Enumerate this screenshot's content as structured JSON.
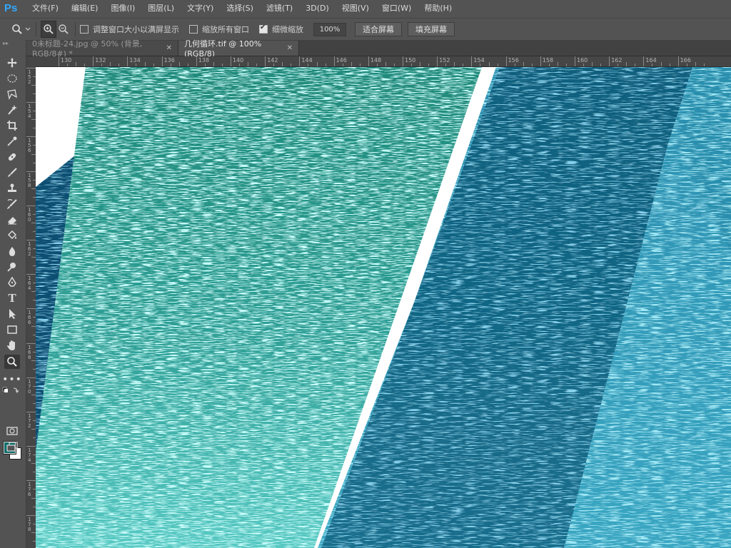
{
  "app": {
    "logo": "Ps"
  },
  "menu": [
    "文件(F)",
    "编辑(E)",
    "图像(I)",
    "图层(L)",
    "文字(Y)",
    "选择(S)",
    "滤镜(T)",
    "3D(D)",
    "视图(V)",
    "窗口(W)",
    "帮助(H)"
  ],
  "options": {
    "resize_windows": "调整窗口大小以满屏显示",
    "resize_windows_checked": false,
    "zoom_all": "缩放所有窗口",
    "zoom_all_checked": false,
    "scrubby_zoom": "细微缩放",
    "scrubby_zoom_checked": true,
    "zoom_value": "100%",
    "fit_screen": "适合屏幕",
    "fill_screen": "填充屏幕"
  },
  "tabs": [
    {
      "label": "0未标题-24.jpg @ 50% (背景, RGB/8#) *",
      "active": false
    },
    {
      "label": "几何循环.tif @ 100%(RGB/8)",
      "active": true
    }
  ],
  "ruler_top": [
    "130",
    "132",
    "134",
    "136",
    "138",
    "140",
    "142",
    "144",
    "146",
    "148",
    "150",
    "152",
    "154",
    "156",
    "158",
    "160",
    "162",
    "164",
    "166"
  ],
  "ruler_left": [
    "152",
    "154",
    "156",
    "158",
    "160",
    "162",
    "164",
    "166",
    "168",
    "170",
    "172",
    "174",
    "176",
    "178"
  ],
  "colors": {
    "foreground": "#0f6e6b",
    "background": "#ffffff"
  },
  "tools": [
    "move-tool",
    "marquee-tool",
    "lasso-tool",
    "quick-select-tool",
    "crop-tool",
    "eyedropper-tool",
    "healing-brush-tool",
    "brush-tool",
    "clone-stamp-tool",
    "history-brush-tool",
    "eraser-tool",
    "paint-bucket-tool",
    "blur-tool",
    "dodge-tool",
    "pen-tool",
    "type-tool",
    "path-select-tool",
    "rectangle-tool",
    "hand-tool",
    "zoom-tool",
    "more-tools",
    "quick-mask",
    "screen-mode"
  ]
}
